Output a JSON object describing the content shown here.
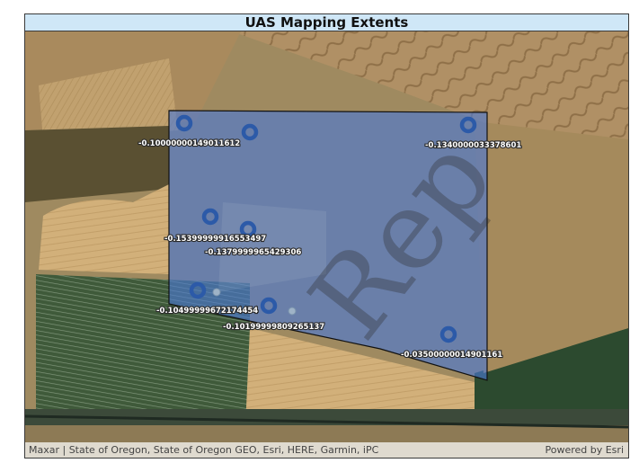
{
  "map": {
    "title": "UAS Mapping Extents",
    "attribution": "Maxar | State of Oregon, State of Oregon GEO, Esri, HERE, Garmin, iPC",
    "powered_by": "Powered by Esri",
    "polygon_color": "#4a79d6",
    "point_color": "#2c5aa8",
    "watermark_text": "Rep",
    "points": [
      {
        "label": "-0.10000000149011612"
      },
      {
        "label": "-0.1340000033378601"
      },
      {
        "label": "-0.15399999916553497"
      },
      {
        "label": "-0.1379999965429306"
      },
      {
        "label": "-0.10499999672174454"
      },
      {
        "label": "-0.10199999809265137"
      },
      {
        "label": "-0.03500000014901161"
      }
    ]
  }
}
